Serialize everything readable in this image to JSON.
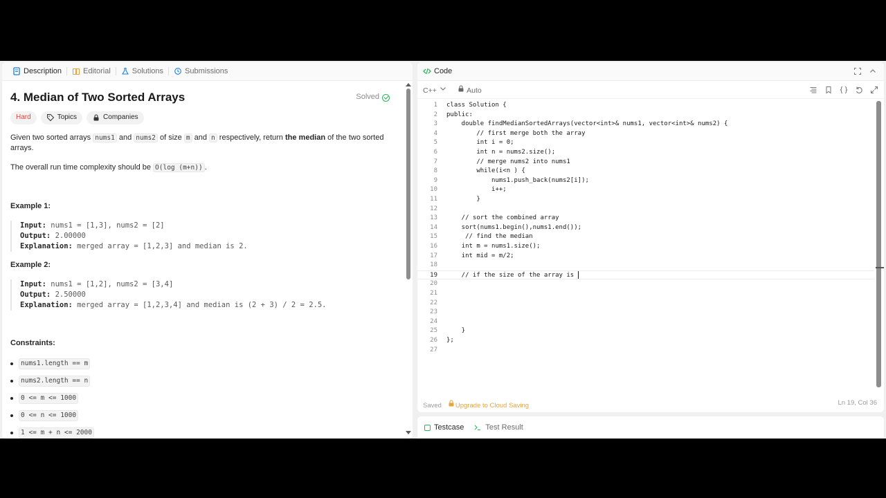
{
  "tabs": [
    {
      "label": "Description",
      "icon": "document-icon"
    },
    {
      "label": "Editorial",
      "icon": "book-icon"
    },
    {
      "label": "Solutions",
      "icon": "flask-icon"
    },
    {
      "label": "Submissions",
      "icon": "history-icon"
    }
  ],
  "problem": {
    "title": "4. Median of Two Sorted Arrays",
    "status": "Solved",
    "difficulty": "Hard",
    "topics_label": "Topics",
    "companies_label": "Companies",
    "statement": {
      "t1": "Given two sorted arrays ",
      "c1": "nums1",
      "t2": " and ",
      "c2": "nums2",
      "t3": " of size ",
      "c3": "m",
      "t4": " and ",
      "c4": "n",
      "t5": " respectively, return ",
      "bold": "the median",
      "t6": " of the two sorted arrays."
    },
    "complexity": {
      "t1": "The overall run time complexity should be ",
      "code": "O(log (m+n))",
      "t2": "."
    },
    "examples": [
      {
        "title": "Example 1:",
        "input_label": "Input:",
        "input": " nums1 = [1,3], nums2 = [2]",
        "output_label": "Output:",
        "output": " 2.00000",
        "explanation_label": "Explanation:",
        "explanation": " merged array = [1,2,3] and median is 2."
      },
      {
        "title": "Example 2:",
        "input_label": "Input:",
        "input": " nums1 = [1,2], nums2 = [3,4]",
        "output_label": "Output:",
        "output": " 2.50000",
        "explanation_label": "Explanation:",
        "explanation": " merged array = [1,2,3,4] and median is (2 + 3) / 2 = 2.5."
      }
    ],
    "constraints_title": "Constraints:",
    "constraints": [
      "nums1.length == m",
      "nums2.length == n",
      "0 <= m <= 1000",
      "0 <= n <= 1000",
      "1 <= m + n <= 2000"
    ]
  },
  "code_panel": {
    "title": "Code",
    "language": "C++",
    "mode": "Auto",
    "lines": [
      "class Solution {",
      "public:",
      "    double findMedianSortedArrays(vector<int>& nums1, vector<int>& nums2) {",
      "        // first merge both the array",
      "        int i = 0;",
      "        int n = nums2.size();",
      "        // merge nums2 into nums1",
      "        while(i<n ) {",
      "            nums1.push_back(nums2[i]);",
      "            i++;",
      "        }",
      "",
      "    // sort the combined array",
      "    sort(nums1.begin(),nums1.end());",
      "     // find the median",
      "    int m = nums1.size();",
      "    int mid = m/2;",
      "",
      "    // if the size of the array is ",
      "",
      "",
      "",
      "",
      "",
      "    }",
      "};",
      ""
    ],
    "current_line": 19,
    "saved_label": "Saved",
    "upgrade_label": "Upgrade to Cloud Saving",
    "cursor_pos": "Ln 19, Col 36"
  },
  "bottom_tabs": [
    {
      "label": "Testcase"
    },
    {
      "label": "Test Result"
    }
  ],
  "colors": {
    "accent_green": "#2db55d",
    "hard_red": "#e2473f",
    "upgrade_orange": "#e8a33c"
  }
}
